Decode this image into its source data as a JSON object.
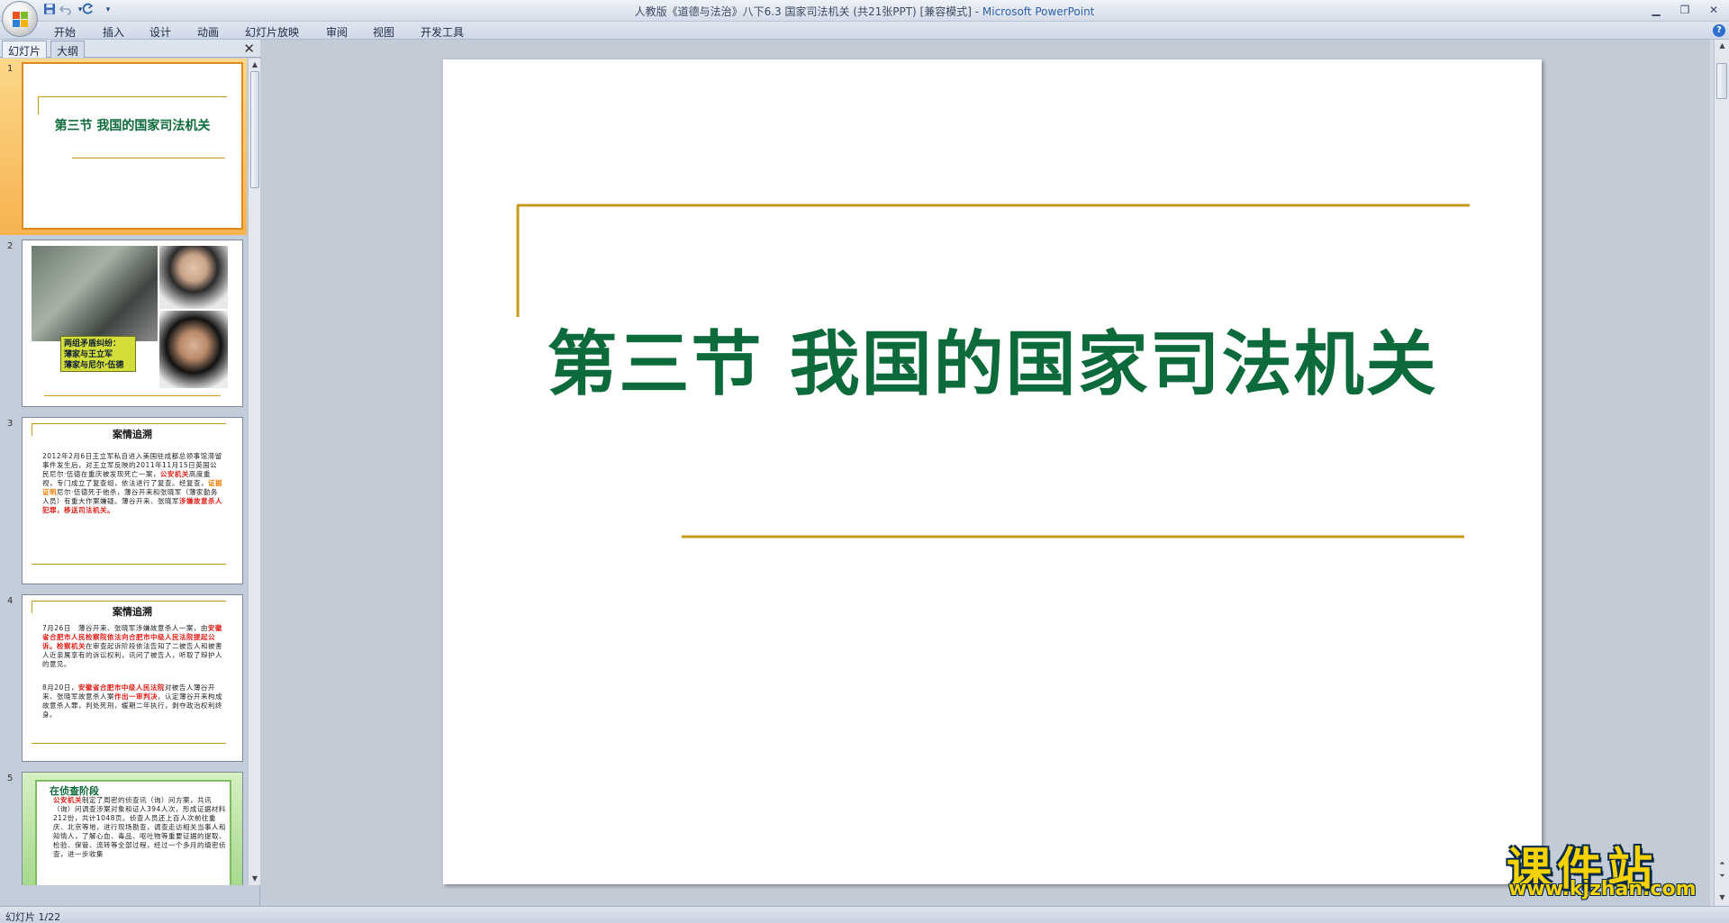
{
  "window": {
    "title": "人教版《道德与法治》八下6.3 国家司法机关 (共21张PPT) [兼容模式] - ",
    "app_name": "Microsoft PowerPoint"
  },
  "quick_access": {
    "save": "save-icon",
    "undo": "undo-icon",
    "redo": "redo-icon",
    "customize": "▾"
  },
  "ribbon": {
    "tabs": [
      "开始",
      "插入",
      "设计",
      "动画",
      "幻灯片放映",
      "审阅",
      "视图",
      "开发工具"
    ],
    "help": "?"
  },
  "left_pane": {
    "tabs": [
      "幻灯片",
      "大纲"
    ],
    "close": "✕",
    "slides": [
      {
        "num": "1",
        "title": "第三节 我国的国家司法机关"
      },
      {
        "num": "2",
        "caption": [
          "两组矛盾纠纷：",
          "薄家与王立军",
          "薄家与尼尔·伍德"
        ]
      },
      {
        "num": "3",
        "heading": "案情追溯",
        "body": "2012年2月6日王立军私自进入美国驻成都总领事馆滞留事件发生后，对王立军反映的2011年11月15日英国公民尼尔·伍德在重庆被发现死亡一案，",
        "body_red": "公安机关",
        "body2": "高度重视，专门成立了复查组，依法进行了复查。经复查，",
        "body_orange": "证据证明",
        "body3": "尼尔·伍德死于他杀，薄谷开来和张晓军（薄家勤务人员）有重大作案嫌疑。薄谷开来、张晓军",
        "body_red2": "涉嫌故意杀人犯罪，移送司法机关。"
      },
      {
        "num": "4",
        "heading": "案情追溯",
        "p1a": "7月26日　薄谷开来、张晓军涉嫌故意杀人一案，由",
        "p1r": "安徽省合肥市人民检察院依法向合肥市中级人民法院提起公诉。检察机关",
        "p1b": "在审查起诉阶段依法告知了二被告人和被害人近亲属享有的诉讼权利，讯问了被告人，听取了辩护人的意见。",
        "p2a": "8月20日，",
        "p2r": "安徽省合肥市中级人民法院",
        "p2b": "对被告人薄谷开来、张晓军故意杀人案",
        "p2r2": "作出一审判决",
        "p2c": "，认定薄谷开来构成故意杀人罪，判处死刑，缓期二年执行，剥夺政治权利终身。"
      },
      {
        "num": "5",
        "heading": "在侦查阶段",
        "body_red": "公安机关",
        "body": "制定了周密的侦查讯（询）问方案，共讯（询）问调查涉案对象和证人394人次，形成证据材料212份，共计1048页。侦查人员还上百人次前往重庆、北京等地，进行现场勘查，调查走访相关当事人和知情人，了解心血、毒品、呕吐物等重要证据的提取、检验、保管、流转等全部过程，经过一个多月的缜密侦查，进一步收集"
      }
    ]
  },
  "slide": {
    "title": "第三节 我国的国家司法机关",
    "accent_color": "#c99a1a",
    "title_color": "#0d6a3a"
  },
  "watermark": {
    "main": "课件站",
    "url": "www.kjzhan.com"
  },
  "status": {
    "slide_counter": "幻灯片 1/22"
  }
}
